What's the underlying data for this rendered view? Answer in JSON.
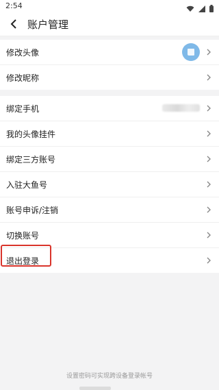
{
  "status_bar": {
    "time": "2:54"
  },
  "header": {
    "title": "账户管理"
  },
  "group1": [
    {
      "label": "修改头像"
    },
    {
      "label": "修改昵称"
    }
  ],
  "group2": [
    {
      "label": "绑定手机"
    },
    {
      "label": "我的头像挂件"
    },
    {
      "label": "绑定三方账号"
    },
    {
      "label": "入驻大鱼号"
    },
    {
      "label": "账号申诉/注销"
    },
    {
      "label": "切换账号"
    },
    {
      "label": "退出登录"
    }
  ],
  "footer": {
    "hint": "设置密码可实现跨设备登录帐号"
  },
  "colors": {
    "highlight": "#d9342b",
    "avatar": "#7fb9e8",
    "background": "#f3f3f4"
  }
}
